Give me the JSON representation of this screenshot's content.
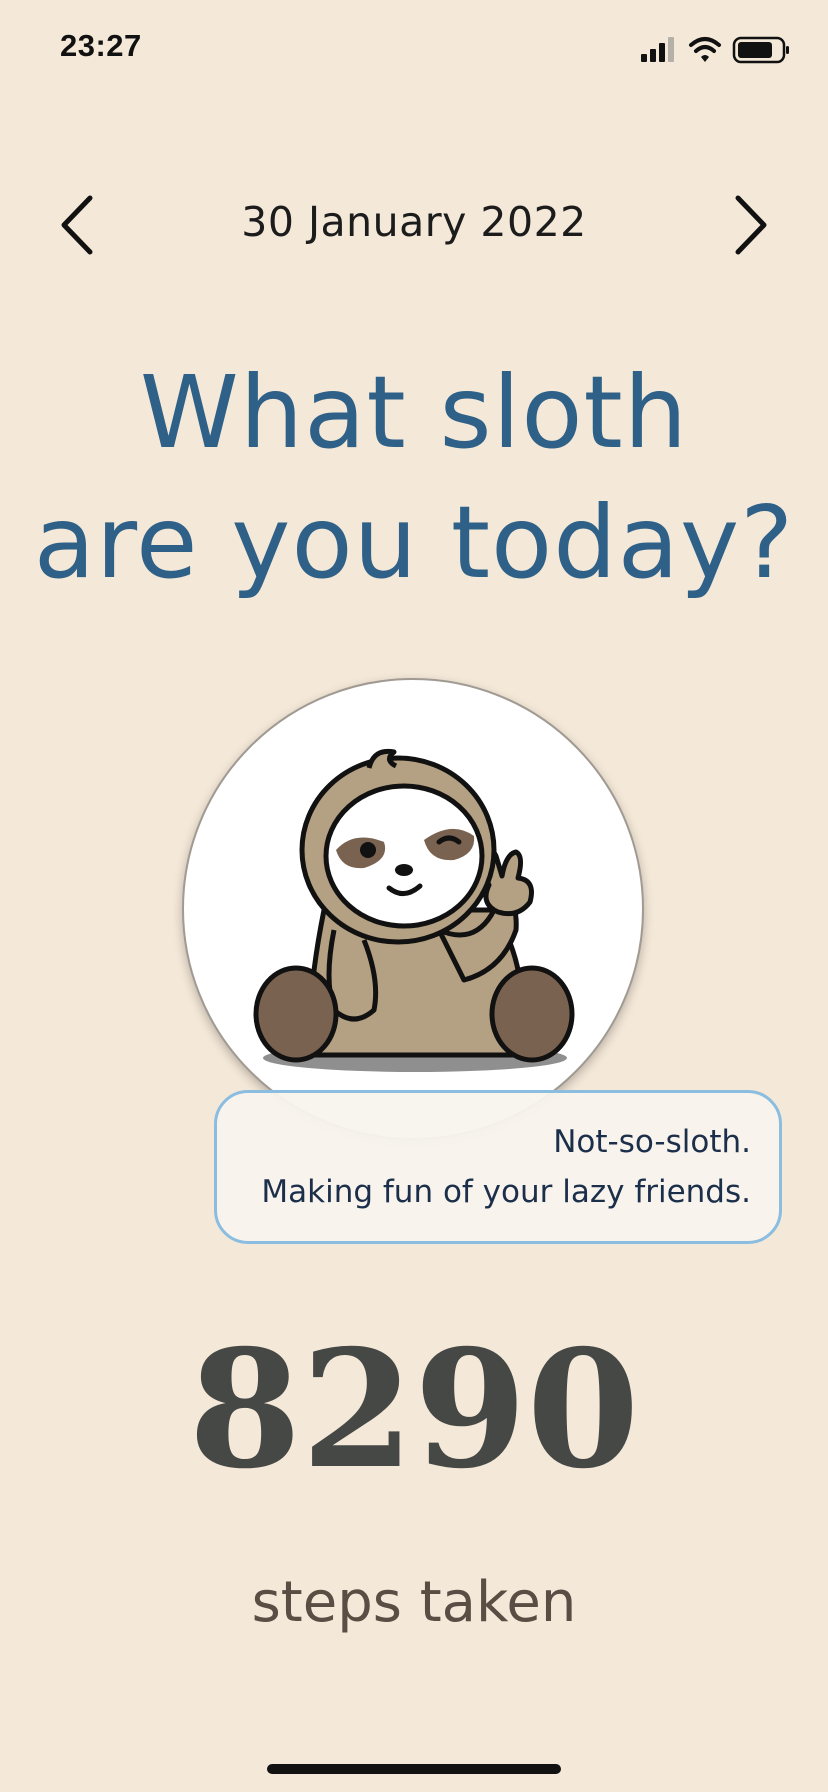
{
  "status_bar": {
    "time": "23:27",
    "icons": [
      "signal-icon",
      "wifi-icon",
      "battery-icon"
    ]
  },
  "date_nav": {
    "prev_icon": "chevron-left-icon",
    "date": "30 January 2022",
    "next_icon": "chevron-right-icon"
  },
  "headline": {
    "line1": "What sloth",
    "line2": "are you today?"
  },
  "sloth": {
    "icon": "sloth-peace-sign-illustration"
  },
  "caption": {
    "line1": "Not-so-sloth.",
    "line2": "Making fun of your lazy friends."
  },
  "steps": {
    "count": "8290",
    "label": "steps taken"
  },
  "colors": {
    "background": "#f4e8d8",
    "headline": "#2f6188",
    "steps": "#454845",
    "bubble_border": "#8bbde0"
  }
}
